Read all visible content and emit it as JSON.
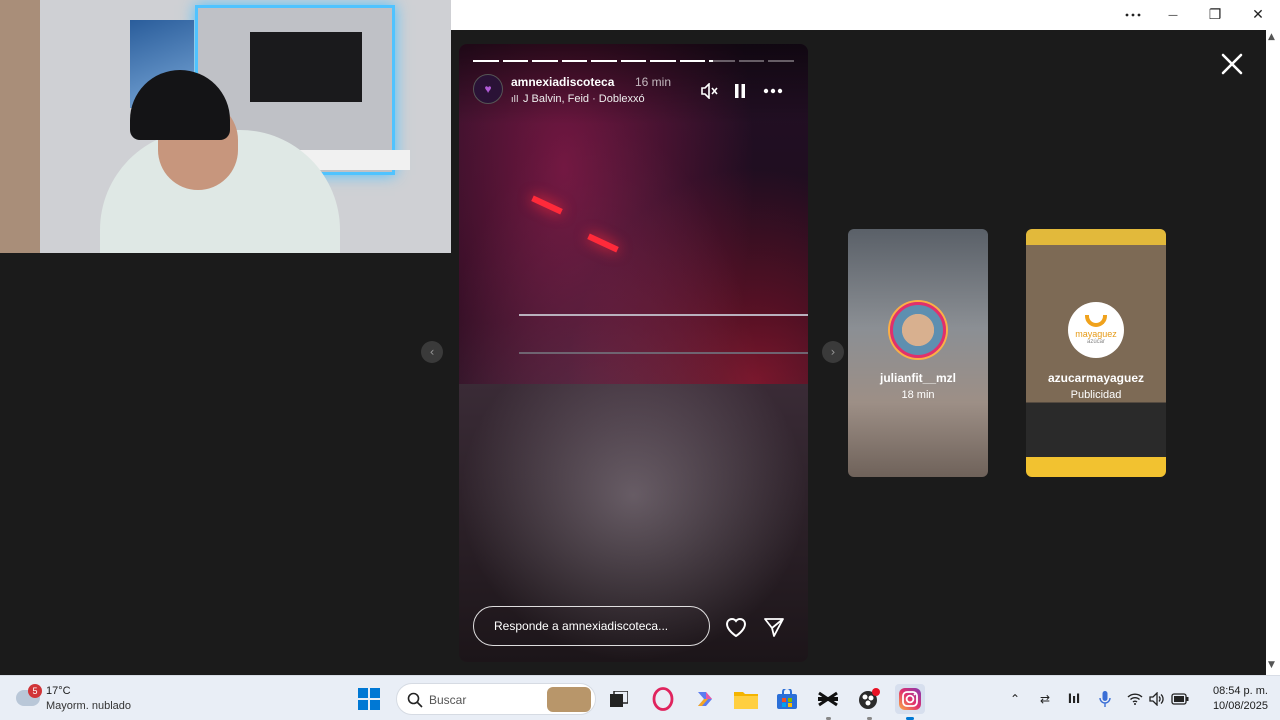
{
  "window": {
    "more_icon": "more-horizontal-icon",
    "minimize_glyph": "—",
    "maximize_glyph": "❐",
    "close_glyph": "✕"
  },
  "story": {
    "username": "amnexiadiscoteca",
    "time": "16 min",
    "music": "J Balvin, Feid · Doblexxó",
    "progress": [
      1,
      1,
      1,
      1,
      1,
      1,
      1,
      1,
      0.15,
      0,
      0
    ],
    "reply_placeholder": "Responde a amnexiadiscoteca..."
  },
  "previews": [
    {
      "username": "julianfit__mzl",
      "subtitle": "18 min"
    },
    {
      "username": "azucarmayaguez",
      "subtitle": "Publicidad",
      "logo_text": "mayaguez",
      "logo_sub": "azúcar"
    }
  ],
  "taskbar": {
    "weather_badge": "5",
    "weather_temp": "17°C",
    "weather_desc": "Mayorm. nublado",
    "search_placeholder": "Buscar",
    "time": "08:54 p. m.",
    "date": "10/08/2025"
  },
  "colors": {
    "instagram_pink": "#e1306c",
    "windows_blue": "#0078d4"
  }
}
